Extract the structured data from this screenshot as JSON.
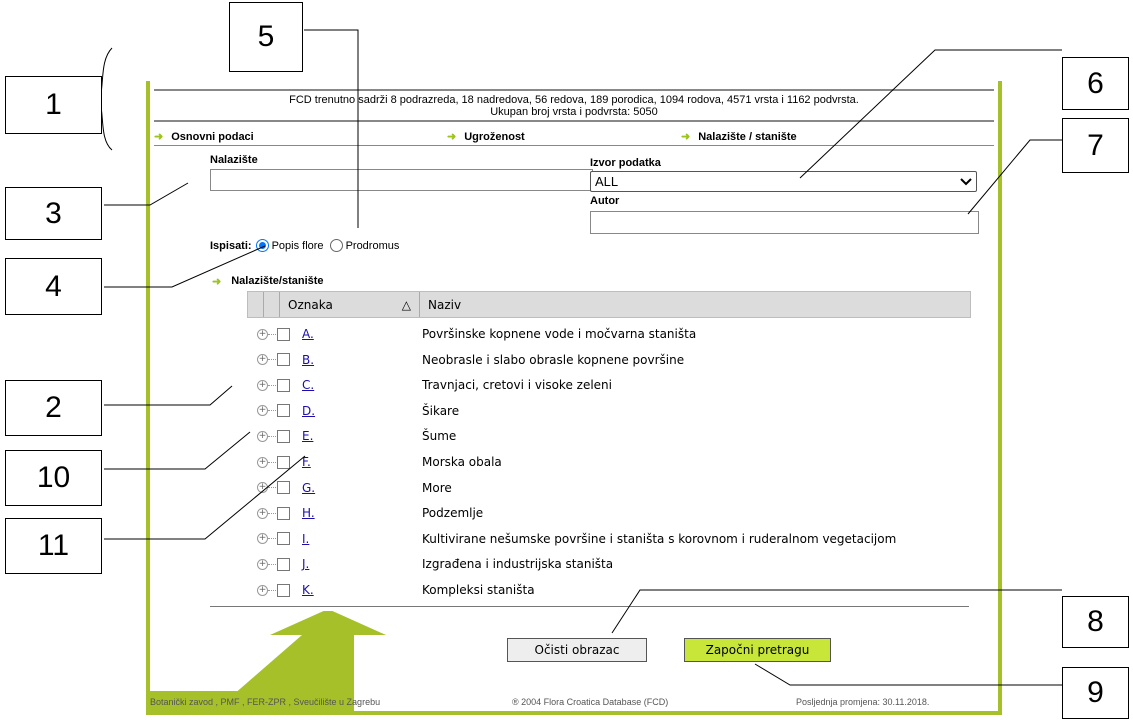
{
  "callouts": [
    "1",
    "2",
    "3",
    "4",
    "5",
    "6",
    "7",
    "8",
    "9",
    "10",
    "11"
  ],
  "summary": {
    "line1": "FCD trenutno sadrži 8 podrazreda, 18 nadredova, 56 redova, 189 porodica, 1094 rodova, 4571 vrsta i 1162 podvrsta.",
    "line2": "Ukupan broj vrsta i podvrsta: 5050"
  },
  "nav": {
    "items": [
      "Osnovni podaci",
      "Ugroženost",
      "Nalazište / stanište"
    ],
    "arrow": "➜"
  },
  "form": {
    "nalaziste_label": "Nalazište",
    "nalaziste_value": "",
    "izvor_label": "Izvor podatka",
    "izvor_value": "ALL",
    "autor_label": "Autor",
    "autor_value": "",
    "ispisati_label": "Ispisati:",
    "option_popis": "Popis flore",
    "option_prodromus": "Prodromus",
    "selected_option": "Popis flore"
  },
  "tree": {
    "section_label": "Nalazište/stanište",
    "col_oznaka": "Oznaka",
    "col_naziv": "Naziv",
    "sort_icon": "△",
    "rows": [
      {
        "code": "A.",
        "name": "Površinske kopnene vode i močvarna staništa"
      },
      {
        "code": "B.",
        "name": "Neobrasle i slabo obrasle kopnene površine"
      },
      {
        "code": "C.",
        "name": "Travnjaci, cretovi i visoke zeleni"
      },
      {
        "code": "D.",
        "name": "Šikare"
      },
      {
        "code": "E.",
        "name": "Šume"
      },
      {
        "code": "F.",
        "name": "Morska obala"
      },
      {
        "code": "G.",
        "name": "More"
      },
      {
        "code": "H.",
        "name": "Podzemlje"
      },
      {
        "code": "I.",
        "name": "Kultivirane nešumske površine i staništa s korovnom i ruderalnom vegetacijom"
      },
      {
        "code": "J.",
        "name": "Izgrađena i industrijska staništa"
      },
      {
        "code": "K.",
        "name": "Kompleksi staništa"
      }
    ]
  },
  "buttons": {
    "clear": "Očisti obrazac",
    "search": "Započni pretragu"
  },
  "footer": {
    "left": "Botanički zavod , PMF , FER-ZPR , Sveučilište u Zagrebu",
    "center": "® 2004 Flora Croatica Database (FCD)",
    "right": "Posljednja promjena: 30.11.2018."
  },
  "colors": {
    "accent": "#a6c02a",
    "search_button": "#c8e63a",
    "link": "#1a0dab",
    "radio": "#0075ff"
  }
}
